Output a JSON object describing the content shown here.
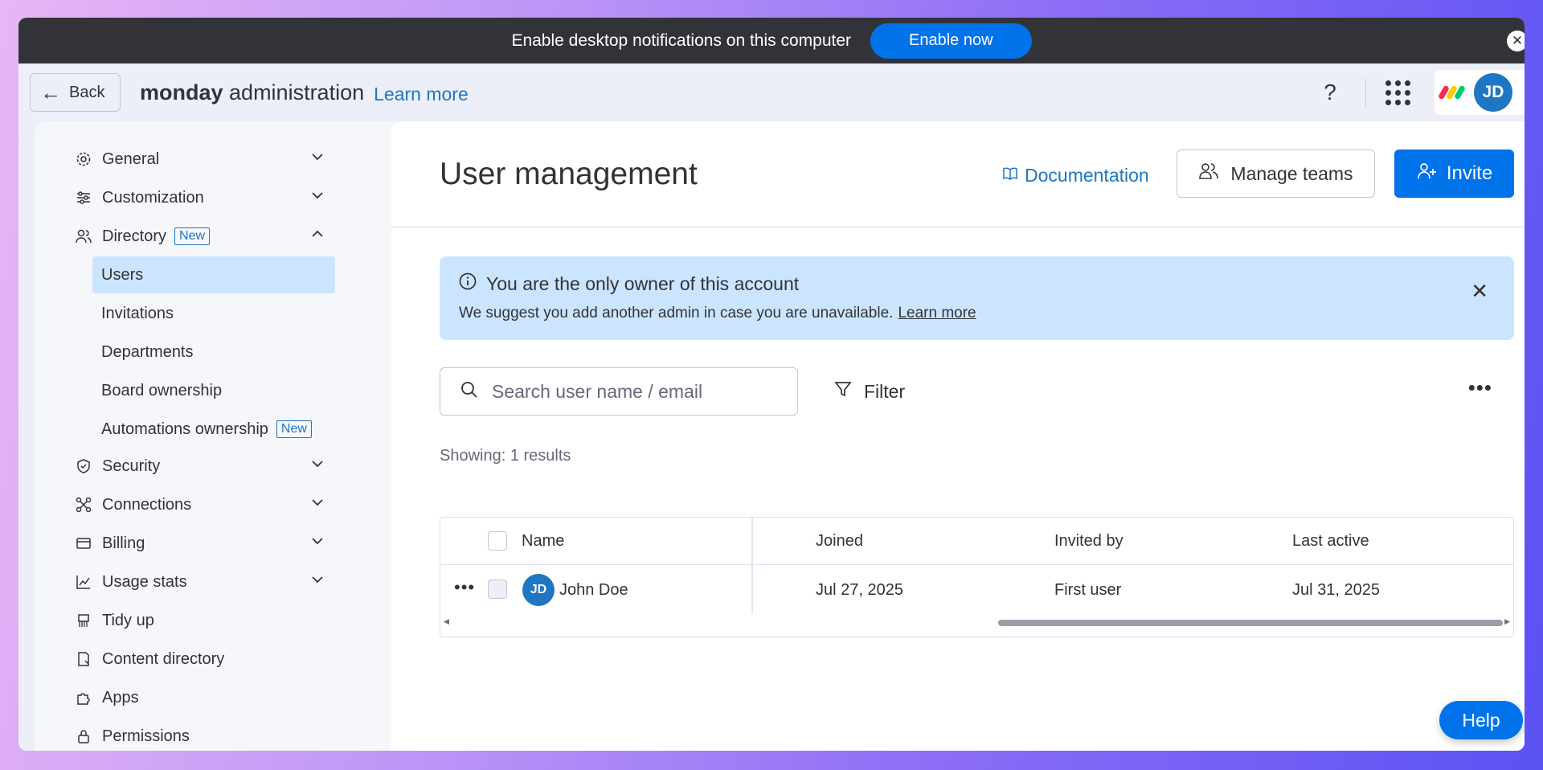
{
  "notification": {
    "message": "Enable desktop notifications on this computer",
    "button_label": "Enable now"
  },
  "topbar": {
    "back_label": "Back",
    "brand_bold": "monday",
    "brand_rest": " administration",
    "learn_more": "Learn more",
    "help_icon": "?",
    "avatar_initials": "JD"
  },
  "sidebar": {
    "items": [
      {
        "label": "General",
        "icon": "gear-icon"
      },
      {
        "label": "Customization",
        "icon": "sliders-icon"
      },
      {
        "label": "Directory",
        "icon": "users-icon",
        "badge": "New"
      },
      {
        "label": "Security",
        "icon": "shield-icon"
      },
      {
        "label": "Connections",
        "icon": "connections-icon"
      },
      {
        "label": "Billing",
        "icon": "credit-card-icon"
      },
      {
        "label": "Usage stats",
        "icon": "chart-icon"
      },
      {
        "label": "Tidy up",
        "icon": "broom-icon"
      },
      {
        "label": "Content directory",
        "icon": "document-icon"
      },
      {
        "label": "Apps",
        "icon": "puzzle-icon"
      },
      {
        "label": "Permissions",
        "icon": "lock-icon"
      }
    ],
    "directory_sub": [
      {
        "label": "Users"
      },
      {
        "label": "Invitations"
      },
      {
        "label": "Departments"
      },
      {
        "label": "Board ownership"
      },
      {
        "label": "Automations ownership",
        "badge": "New"
      }
    ]
  },
  "main": {
    "title": "User management",
    "documentation": "Documentation",
    "manage_teams": "Manage teams",
    "invite": "Invite",
    "alert": {
      "title": "You are the only owner of this account",
      "body": "We suggest you add another admin in case you are unavailable.",
      "link": "Learn more"
    },
    "search_placeholder": "Search user name / email",
    "filter": "Filter",
    "results": "Showing: 1 results",
    "table": {
      "headers": [
        "Name",
        "Joined",
        "Invited by",
        "Last active"
      ],
      "rows": [
        {
          "initials": "JD",
          "name": "John Doe",
          "joined": "Jul 27, 2025",
          "invited_by": "First user",
          "last_active": "Jul 31, 2025"
        }
      ]
    }
  },
  "help_button": "Help",
  "colors": {
    "primary": "#0073ea",
    "link": "#1f76c2",
    "active_bg": "#cce5ff",
    "dark": "#323338"
  }
}
